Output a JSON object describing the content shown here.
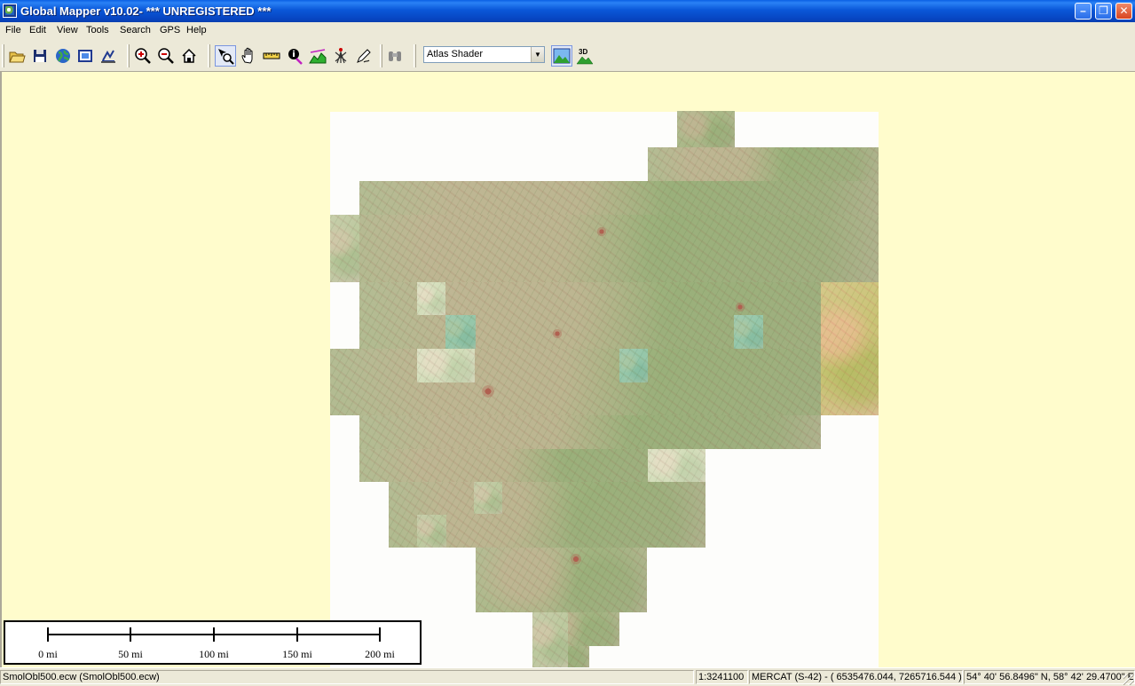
{
  "window": {
    "title": "Global Mapper v10.02- *** UNREGISTERED ***",
    "minimize": "–",
    "restore": "❐",
    "close": "✕"
  },
  "menu": {
    "items": [
      "File",
      "Edit",
      "View",
      "Tools",
      "Search",
      "GPS",
      "Help"
    ]
  },
  "toolbar": {
    "buttons": [
      {
        "name": "open-icon",
        "pressed": false
      },
      {
        "name": "save-icon",
        "pressed": false
      },
      {
        "name": "globe-download-icon",
        "pressed": false
      },
      {
        "name": "map-catalog-icon",
        "pressed": false
      },
      {
        "name": "configure-icon",
        "pressed": false
      },
      {
        "name": "zoom-in-icon",
        "pressed": false
      },
      {
        "name": "zoom-out-icon",
        "pressed": false
      },
      {
        "name": "home-icon",
        "pressed": false
      },
      {
        "name": "zoom-tool-icon",
        "pressed": true
      },
      {
        "name": "pan-hand-icon",
        "pressed": false
      },
      {
        "name": "measure-ruler-icon",
        "pressed": false
      },
      {
        "name": "feature-info-icon",
        "pressed": false
      },
      {
        "name": "path-profile-icon",
        "pressed": false
      },
      {
        "name": "view-shed-icon",
        "pressed": false
      },
      {
        "name": "digitizer-icon",
        "pressed": false
      },
      {
        "name": "binoculars-icon",
        "pressed": false
      },
      {
        "name": "shaded-relief-icon",
        "pressed": true
      },
      {
        "name": "3d-view-icon",
        "pressed": false
      }
    ],
    "shader_select": {
      "value": "Atlas Shader"
    },
    "view3d_label": "3D"
  },
  "scale_bar": {
    "labels": [
      "0 mi",
      "50 mi",
      "100 mi",
      "150 mi",
      "200 mi"
    ]
  },
  "status": {
    "file": "SmolObl500.ecw (SmolObl500.ecw)",
    "scale": "1:3241100",
    "projection": "MERCAT (S-42) - ( 6535476.044, 7265716.544 )",
    "latlon": "54° 40' 56.8496\" N, 58° 42' 29.4700\" E"
  },
  "colors": {
    "title_bar": "#0a57d8",
    "chrome": "#ece9d8",
    "map_background": "#fffccc"
  }
}
